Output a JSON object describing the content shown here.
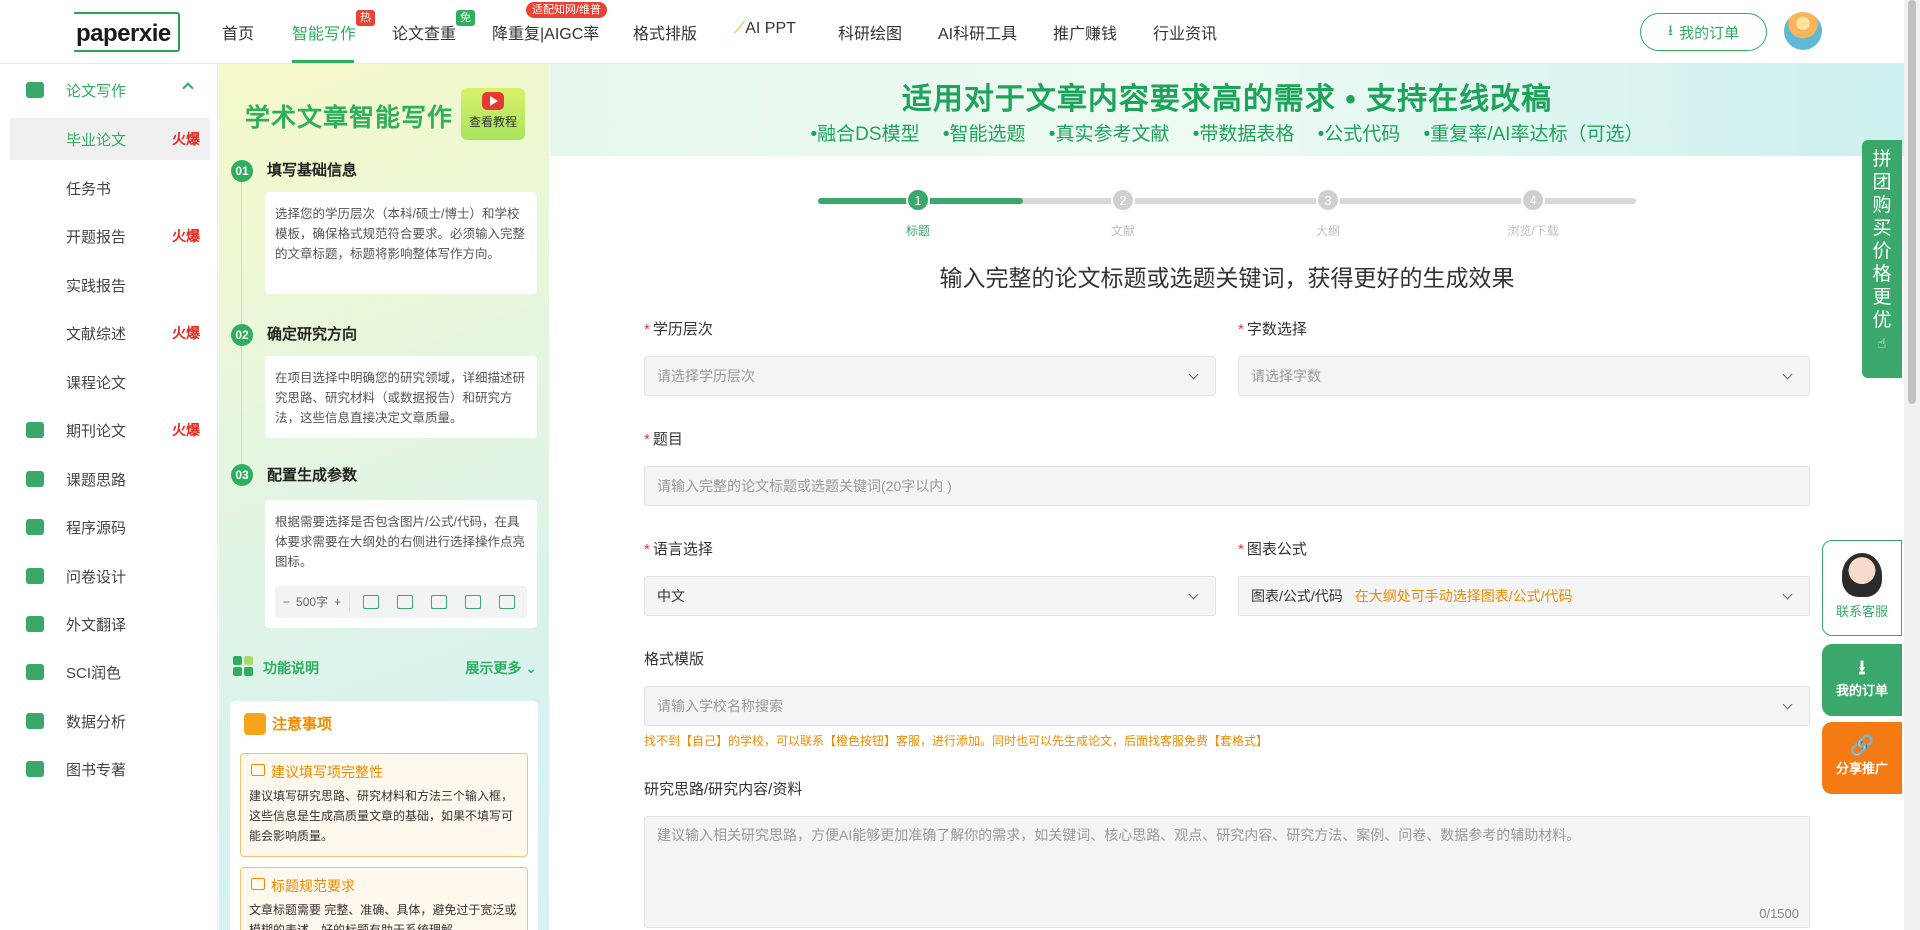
{
  "header": {
    "logo": "paperxie",
    "nav": [
      {
        "label": "首页"
      },
      {
        "label": "智能写作",
        "badge": "热"
      },
      {
        "label": "论文查重",
        "badge": "免"
      },
      {
        "label": "降重复|AIGC率",
        "badge": "适配知网/维普"
      },
      {
        "label": "格式排版"
      },
      {
        "label": "AI PPT"
      },
      {
        "label": "科研绘图"
      },
      {
        "label": "AI科研工具"
      },
      {
        "label": "推广赚钱"
      },
      {
        "label": "行业资讯"
      }
    ],
    "order_button": "我的订单"
  },
  "sidebar": {
    "items": [
      {
        "label": "论文写作",
        "icon": "document-icon"
      },
      {
        "label": "毕业论文",
        "hot": "火爆"
      },
      {
        "label": "任务书"
      },
      {
        "label": "开题报告",
        "hot": "火爆"
      },
      {
        "label": "实践报告"
      },
      {
        "label": "文献综述",
        "hot": "火爆"
      },
      {
        "label": "课程论文"
      },
      {
        "label": "期刊论文",
        "hot": "火爆",
        "icon": "journal-icon"
      },
      {
        "label": "课题思路",
        "icon": "idea-icon"
      },
      {
        "label": "程序源码",
        "icon": "code-icon"
      },
      {
        "label": "问卷设计",
        "icon": "survey-icon"
      },
      {
        "label": "外文翻译",
        "icon": "translate-icon"
      },
      {
        "label": "SCI润色",
        "icon": "sci-icon"
      },
      {
        "label": "数据分析",
        "icon": "chart-icon"
      },
      {
        "label": "图书专著",
        "icon": "book-icon"
      }
    ]
  },
  "guide": {
    "title": "学术文章智能写作",
    "tutorial": "查看教程",
    "steps": [
      {
        "num": "01",
        "title": "填写基础信息",
        "desc": "选择您的学历层次（本科/硕士/博士）和学校模板，确保格式规范符合要求。必须输入完整的文章标题，标题将影响整体写作方向。"
      },
      {
        "num": "02",
        "title": "确定研究方向",
        "desc": "在项目选择中明确您的研究领域，详细描述研究思路、研究材料（或数据报告）和研究方法，这些信息直接决定文章质量。"
      },
      {
        "num": "03",
        "title": "配置生成参数",
        "desc": "根据需要选择是否包含图片/公式/代码，在具体要求需要在大纲处的右侧进行选择操作点亮图标。"
      }
    ],
    "word_count": "500字",
    "func_title": "功能说明",
    "func_more": "展示更多",
    "notes_title": "注意事项",
    "notes": [
      {
        "title": "建议填写项完整性",
        "desc": "建议填写研究思路、研究材料和方法三个输入框，这些信息是生成高质量文章的基础，如果不填写可能会影响质量。"
      },
      {
        "title": "标题规范要求",
        "desc": "文章标题需要 完整、准确、具体，避免过于宽泛或模糊的表述，好的标题有助于系统理解"
      }
    ]
  },
  "main": {
    "banner_title": "适用对于文章内容要求高的需求 • 支持在线改稿",
    "banner_features": "•融合DS模型 •智能选题 •真实参考文献 •带数据表格 •公式代码 •重复率/AI率达标（可选）",
    "steps": [
      "标题",
      "文献",
      "大纲",
      "浏览/下载"
    ],
    "current_step": 1,
    "progress": 0.25,
    "subtitle": "输入完整的论文标题或选题关键词，获得更好的生成效果",
    "form": {
      "education_label": "学历层次",
      "education_placeholder": "请选择学历层次",
      "words_label": "字数选择",
      "words_placeholder": "请选择字数",
      "title_label": "题目",
      "title_placeholder": "请输入完整的论文标题或选题关键词(20字以内 )",
      "language_label": "语言选择",
      "language_value": "中文",
      "chart_label": "图表公式",
      "chart_value": "图表/公式/代码",
      "chart_hint": "在大纲处可手动选择图表/公式/代码",
      "template_label": "格式模版",
      "template_placeholder": "请输入学校名称搜索",
      "template_warn": "找不到【自己】的学校，可以联系【橙色按钮】客服，进行添加。同时也可以先生成论文，后面找客服免费【套格式】",
      "research_label": "研究思路/研究内容/资料",
      "research_placeholder": "建议输入相关研究思路，方便AI能够更加准确了解你的需求，如关键词、核心思路、观点、研究内容、研究方法、案例、问卷、数据参考的辅助材料。",
      "research_counter": "0/1500"
    }
  },
  "float": {
    "group_text": [
      "拼",
      "团",
      "购",
      "买",
      "价",
      "格",
      "更",
      "优"
    ],
    "service": "联系客服",
    "orders": "我的订单",
    "share": "分享推广"
  },
  "colors": {
    "accent": "#2fae5f",
    "hot": "#e02d20",
    "warn": "#f08a00"
  }
}
